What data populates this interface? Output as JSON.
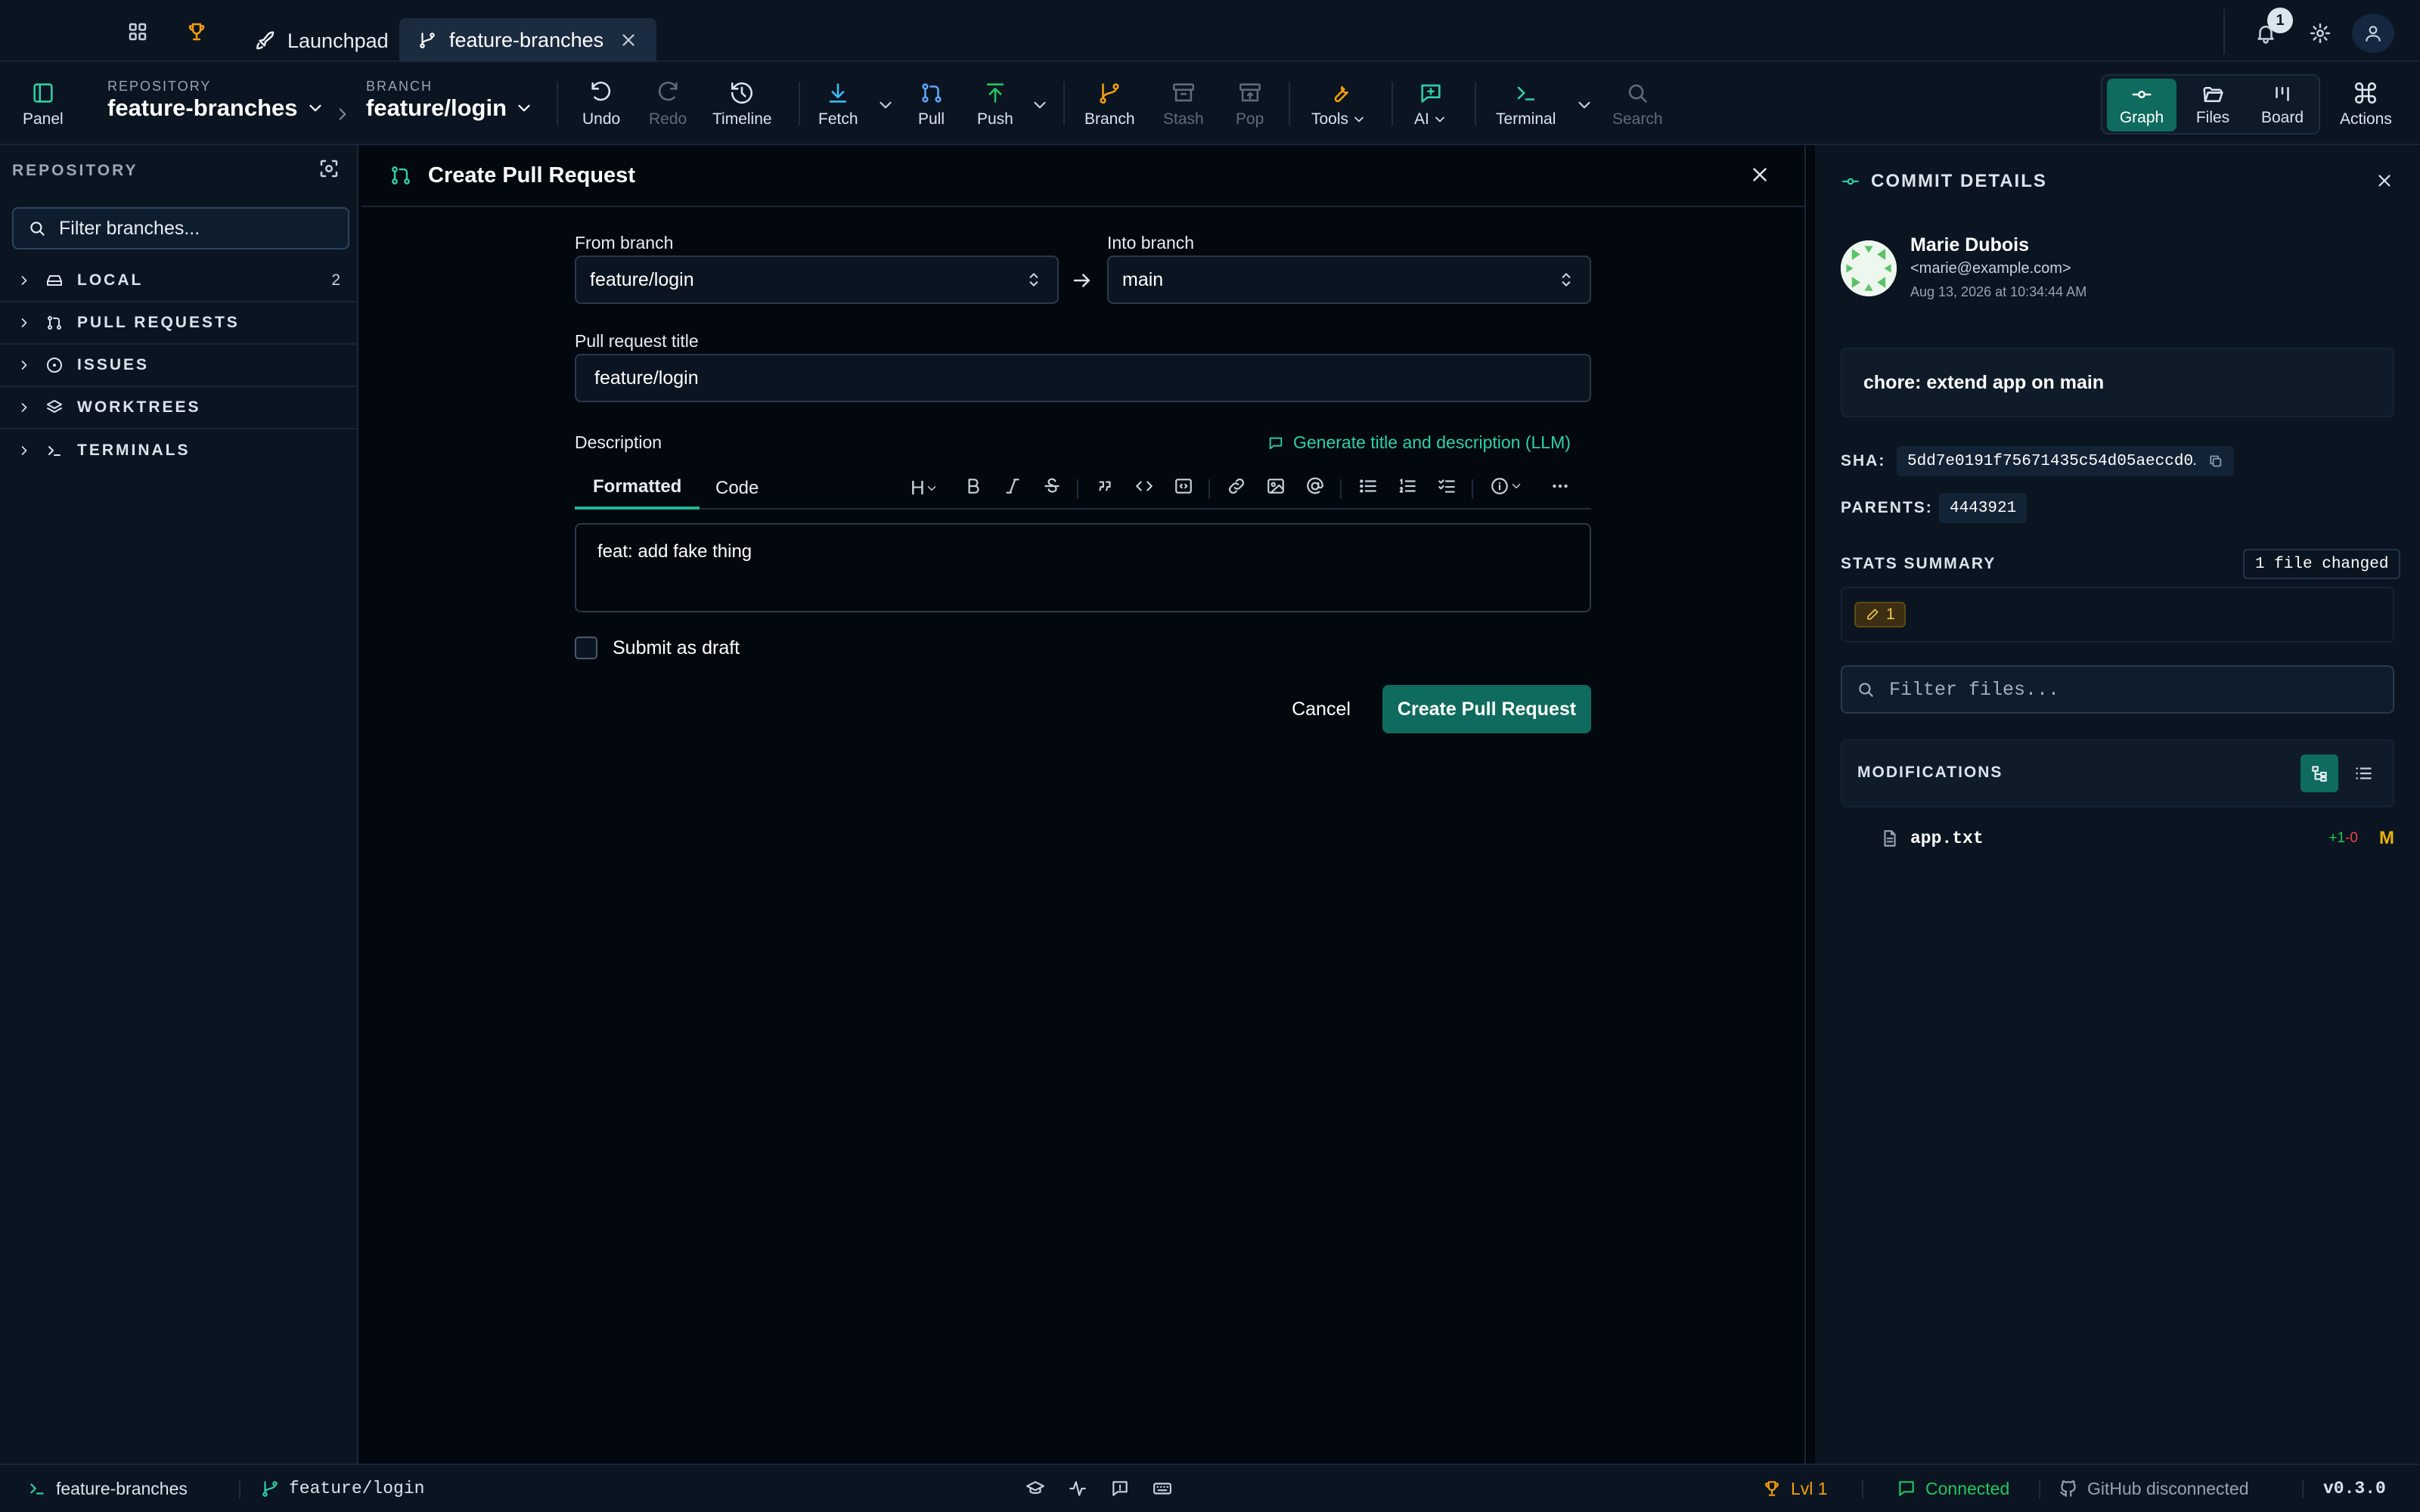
{
  "titlebar": {
    "tabs": [
      {
        "label": "Launchpad"
      },
      {
        "label": "feature-branches"
      }
    ],
    "notifications_count": "1"
  },
  "toolbar": {
    "panel_label": "Panel",
    "repository_label": "REPOSITORY",
    "repository_value": "feature-branches",
    "branch_label": "BRANCH",
    "branch_value": "feature/login",
    "undo": "Undo",
    "redo": "Redo",
    "timeline": "Timeline",
    "fetch": "Fetch",
    "pull": "Pull",
    "push": "Push",
    "branch": "Branch",
    "stash": "Stash",
    "pop": "Pop",
    "tools": "Tools",
    "ai": "AI",
    "terminal": "Terminal",
    "search": "Search",
    "views": {
      "graph": "Graph",
      "files": "Files",
      "board": "Board"
    },
    "actions": "Actions"
  },
  "sidebar": {
    "header": "REPOSITORY",
    "filter_placeholder": "Filter branches...",
    "sections": [
      {
        "label": "LOCAL",
        "count": "2"
      },
      {
        "label": "PULL REQUESTS"
      },
      {
        "label": "ISSUES"
      },
      {
        "label": "WORKTREES"
      },
      {
        "label": "TERMINALS"
      }
    ]
  },
  "pr_form": {
    "title": "Create Pull Request",
    "from_label": "From branch",
    "from_value": "feature/login",
    "into_label": "Into branch",
    "into_value": "main",
    "pr_title_label": "Pull request title",
    "pr_title_value": "feature/login",
    "description_label": "Description",
    "generate_link": "Generate title and description (LLM)",
    "tabs": [
      "Formatted",
      "Code"
    ],
    "description_value": "feat: add fake thing",
    "draft_label": "Submit as draft",
    "cancel": "Cancel",
    "submit": "Create Pull Request"
  },
  "commit_details": {
    "title": "COMMIT DETAILS",
    "author_name": "Marie Dubois",
    "author_email": "<marie@example.com>",
    "date": "Aug 13, 2026 at 10:34:44 AM",
    "message": "chore: extend app on main",
    "sha_label": "SHA:",
    "sha_value": "5dd7e0191f75671435c54d05aeccd0…",
    "parents_label": "PARENTS:",
    "parents_value": "4443921",
    "stats_label": "STATS SUMMARY",
    "files_changed": "1 file changed",
    "modified_count": "1",
    "filter_placeholder": "Filter files...",
    "modifications_label": "MODIFICATIONS",
    "files": [
      {
        "name": "app.txt",
        "added": "+1",
        "removed": "-0",
        "status": "M"
      }
    ]
  },
  "statusbar": {
    "repo": "feature-branches",
    "branch": "feature/login",
    "level": "Lvl 1",
    "connection": "Connected",
    "github": "GitHub disconnected",
    "version": "v0.3.0"
  },
  "colors": {
    "accent": "#0f6b5e",
    "accent_text": "#2fd0a7",
    "trophy": "#f59e0b",
    "added": "#22c55e",
    "removed": "#ef4444",
    "modified": "#eab308"
  }
}
